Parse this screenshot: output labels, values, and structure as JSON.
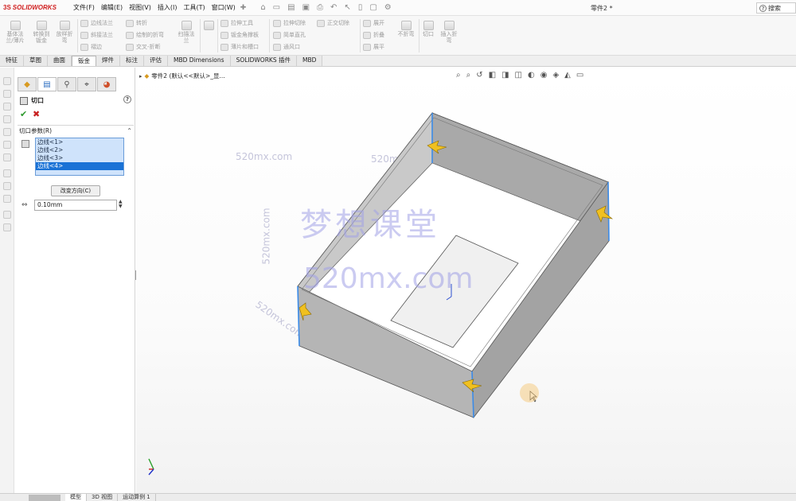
{
  "app": {
    "logo_ds": "3S",
    "logo_name": "SOLIDWORKS",
    "menus": [
      "文件(F)",
      "编辑(E)",
      "视图(V)",
      "插入(I)",
      "工具(T)",
      "窗口(W)"
    ],
    "document_title": "零件2 *",
    "search_label": "搜索"
  },
  "toolbar": {
    "big_tools": [
      {
        "label": "基体法\n兰/薄片"
      },
      {
        "label": "转换到\n钣金"
      },
      {
        "label": "放样折\n弯"
      }
    ],
    "col1": [
      "边线法兰",
      "斜接法兰",
      "褶边"
    ],
    "col2": [
      "转折",
      "绘制的折弯",
      "交叉-折断"
    ],
    "tool_corner": "扫描法\n兰",
    "col3": [
      "拉伸工具",
      "钣金角撑板",
      "薄片和槽口"
    ],
    "col4": [
      "拉伸切除",
      "简单直孔",
      "通风口"
    ],
    "col5": [
      "正交切除"
    ],
    "col6": [
      "展开",
      "折叠",
      "展平"
    ],
    "tool_nofold": "不折弯",
    "tool_cut": "切口",
    "tool_insert_bend": "插入折\n弯"
  },
  "tabs": [
    "特征",
    "草图",
    "曲面",
    "钣金",
    "焊件",
    "标注",
    "评估",
    "MBD Dimensions",
    "SOLIDWORKS 插件",
    "MBD"
  ],
  "active_tab": "钣金",
  "property_manager": {
    "title": "切口",
    "help": "?",
    "group_title": "切口参数(R)",
    "edges": [
      "边线<1>",
      "边线<2>",
      "边线<3>",
      "边线<4>"
    ],
    "selected_edge_index": 3,
    "reverse_button": "改变方向(C)",
    "gap_value": "0.10mm"
  },
  "tree_flyout": "零件2 (默认<<默认>_显...",
  "watermark": {
    "chinese": "梦想课堂",
    "url": "520mx.com",
    "small": "520mx.com"
  },
  "status_tabs": [
    "模型",
    "3D 视图",
    "运动算例 1"
  ],
  "active_status_tab": "模型",
  "colors": {
    "brand_red": "#d02020",
    "selection_blue": "#1a72d6",
    "list_bg": "#cfe3fb",
    "part_face": "#b9b9b9",
    "edge_highlight": "#3b8be8",
    "handle_yellow": "#f0c020"
  }
}
